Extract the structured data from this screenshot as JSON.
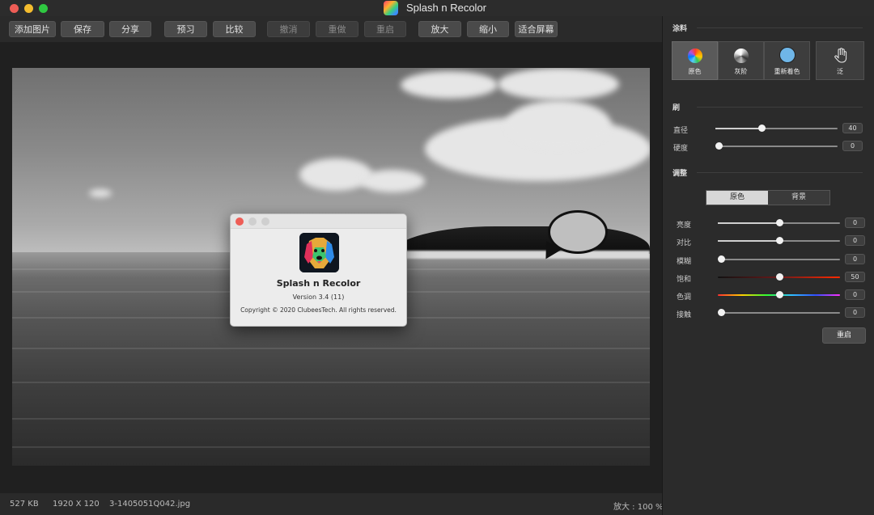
{
  "window": {
    "title": "Splash n Recolor"
  },
  "toolbar": {
    "buttons": [
      {
        "label": "添加图片",
        "enabled": true
      },
      {
        "label": "保存",
        "enabled": true
      },
      {
        "label": "分享",
        "enabled": true
      },
      {
        "label": "预习",
        "enabled": true
      },
      {
        "label": "比较",
        "enabled": true
      },
      {
        "label": "撤消",
        "enabled": false
      },
      {
        "label": "重做",
        "enabled": false
      },
      {
        "label": "重启",
        "enabled": false
      },
      {
        "label": "放大",
        "enabled": true
      },
      {
        "label": "缩小",
        "enabled": true
      },
      {
        "label": "适合屏幕",
        "enabled": true
      }
    ]
  },
  "about": {
    "app_name": "Splash n Recolor",
    "version": "Version 3.4 (11)",
    "copyright": "Copyright © 2020 ClubeesTech. All rights reserved."
  },
  "status": {
    "file_size": "527 KB",
    "dimensions": "1920 X 120",
    "file_name": "3-1405051Q042.jpg",
    "zoom": "放大 : 100 %"
  },
  "panel": {
    "paint": {
      "title": "涂料",
      "modes": [
        {
          "label": "原色",
          "icon": "color-wheel-icon",
          "active": true
        },
        {
          "label": "灰阶",
          "icon": "grayscale-wheel-icon",
          "active": false
        },
        {
          "label": "重新着色",
          "icon": "recolor-circle-icon",
          "active": false
        }
      ],
      "pan_label": "泛",
      "pan_icon": "hand-icon",
      "recolor_swatch": "#6fb6e8"
    },
    "brush": {
      "title": "刷",
      "diameter": {
        "label": "直径",
        "value": "40",
        "fraction": 0.38
      },
      "hardness": {
        "label": "硬度",
        "value": "0",
        "fraction": 0.0
      }
    },
    "adjust": {
      "title": "调整",
      "tabs": [
        {
          "label": "原色",
          "active": true
        },
        {
          "label": "背景",
          "active": false
        }
      ],
      "rows": [
        {
          "label": "亮度",
          "value": "0",
          "fraction": 0.5,
          "track": "plain"
        },
        {
          "label": "对比",
          "value": "0",
          "fraction": 0.5,
          "track": "plain"
        },
        {
          "label": "模糊",
          "value": "0",
          "fraction": 0.0,
          "track": "plain"
        },
        {
          "label": "饱和",
          "value": "50",
          "fraction": 0.5,
          "track": "saturation"
        },
        {
          "label": "色调",
          "value": "0",
          "fraction": 0.5,
          "track": "hue"
        },
        {
          "label": "接触",
          "value": "0",
          "fraction": 0.0,
          "track": "plain"
        }
      ],
      "reset_label": "重启"
    }
  }
}
